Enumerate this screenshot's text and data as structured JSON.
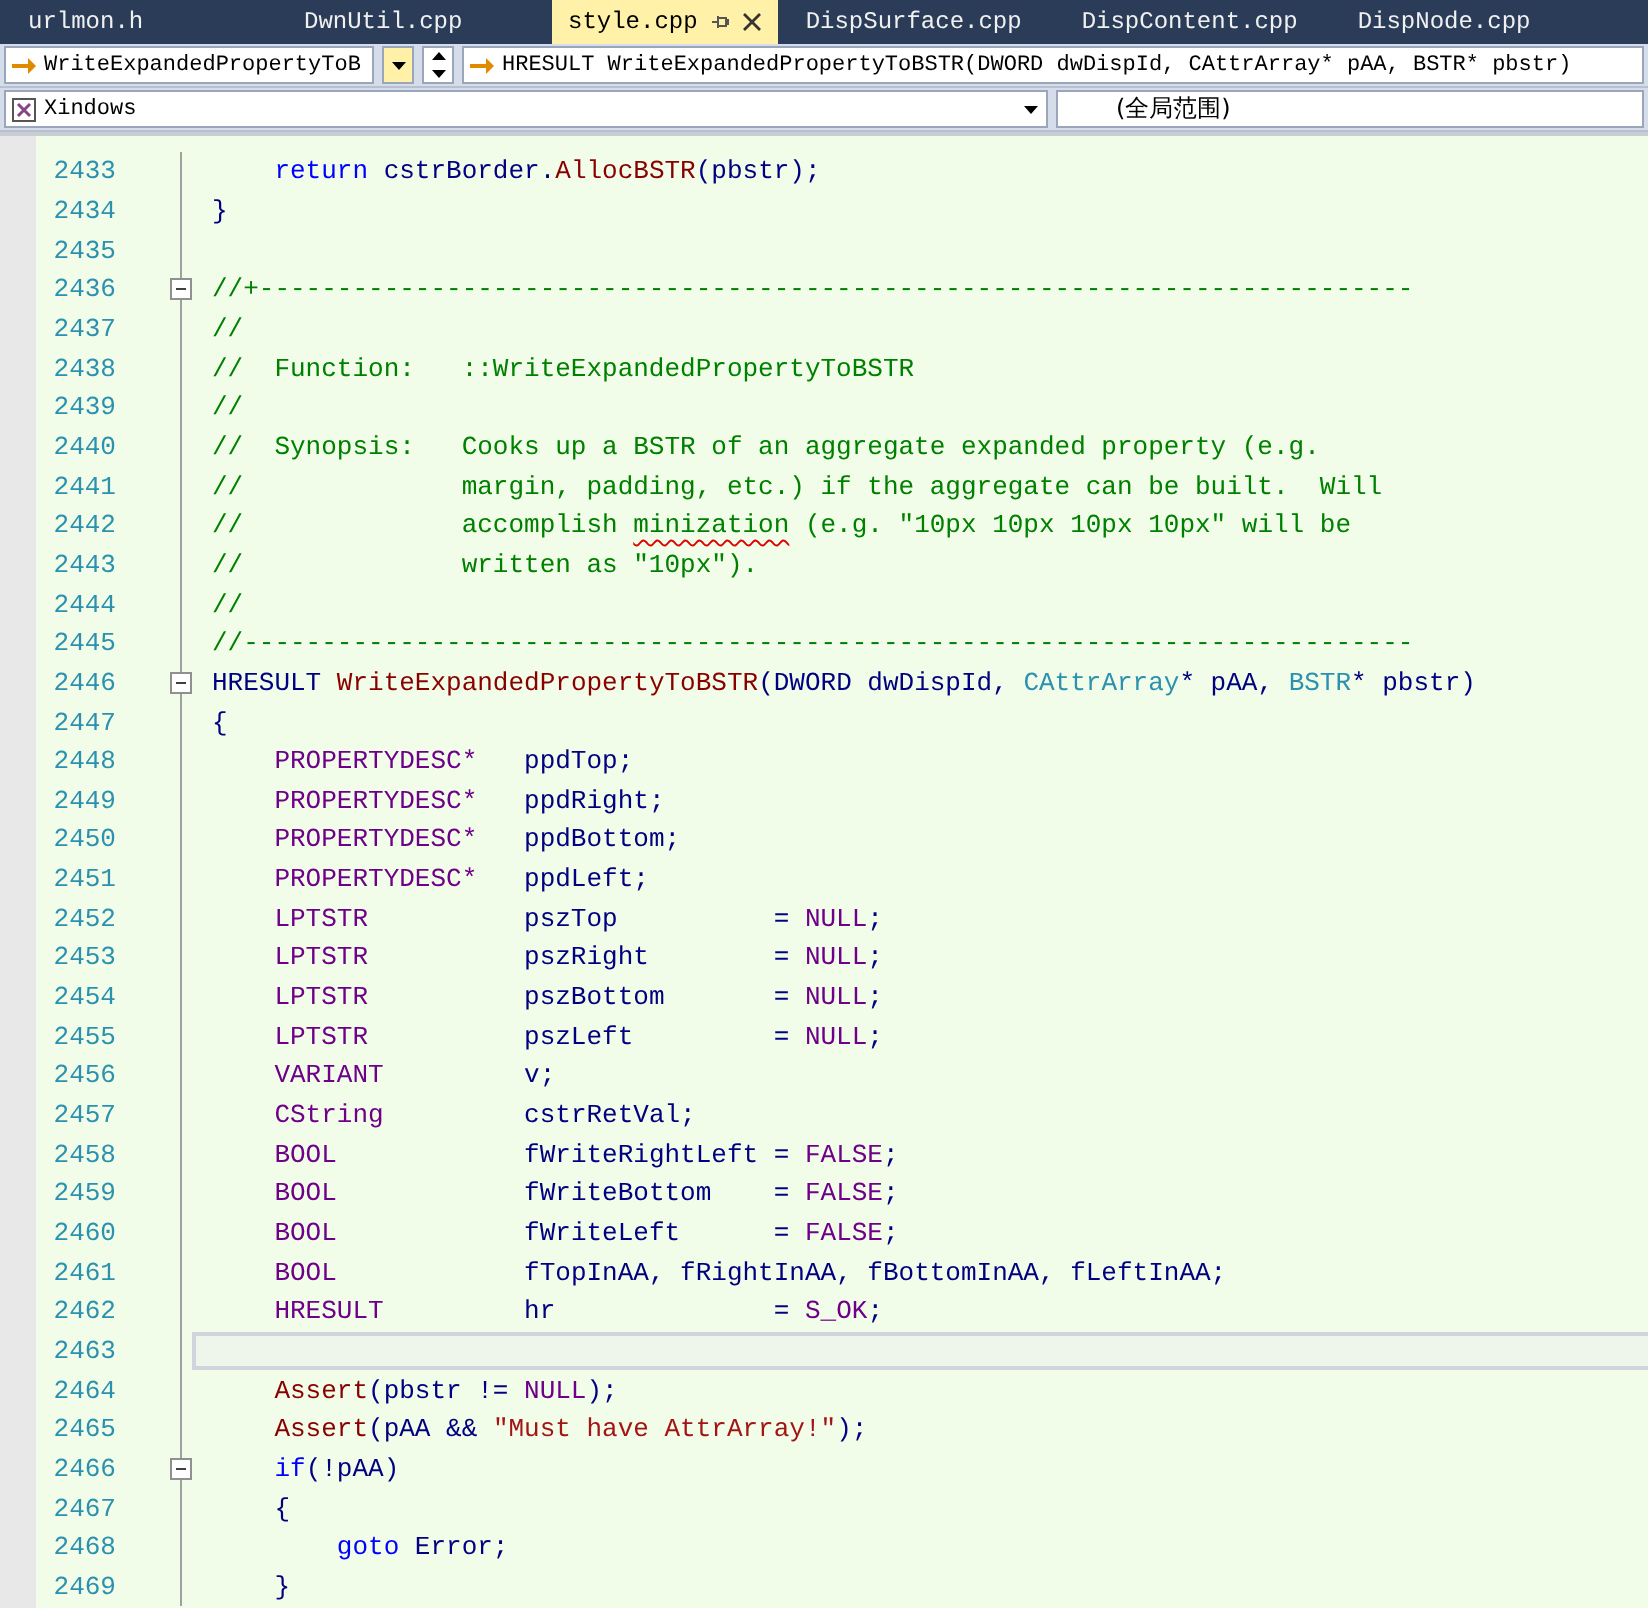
{
  "tabs": [
    {
      "label": "urlmon.h",
      "selected": false,
      "pinned": false
    },
    {
      "label": "DwnUtil.cpp",
      "selected": false,
      "pinned": false
    },
    {
      "label": "style.cpp",
      "selected": true,
      "pinned": true
    },
    {
      "label": "DispSurface.cpp",
      "selected": false,
      "pinned": false
    },
    {
      "label": "DispContent.cpp",
      "selected": false,
      "pinned": false
    },
    {
      "label": "DispNode.cpp",
      "selected": false,
      "pinned": false
    }
  ],
  "navigation": {
    "function_dropdown": "WriteExpandedPropertyToB",
    "signature": "HRESULT WriteExpandedPropertyToBSTR(DWORD dwDispId, CAttrArray* pAA, BSTR* pbstr)",
    "project_dropdown": "Xindows",
    "scope": "(全局范围)"
  },
  "editor": {
    "lines": [
      {
        "number": "2433",
        "collapsible": false,
        "current": false,
        "tokens": [
          {
            "text": "    return",
            "kind": "keyword"
          },
          {
            "text": " cstrBorder.",
            "kind": "plain"
          },
          {
            "text": "AllocBSTR",
            "kind": "function"
          },
          {
            "text": "(pbstr);",
            "kind": "plain"
          }
        ]
      },
      {
        "number": "2434",
        "collapsible": false,
        "current": false,
        "tokens": [
          {
            "text": "}",
            "kind": "plain"
          }
        ]
      },
      {
        "number": "2435",
        "collapsible": false,
        "current": false
      },
      {
        "number": "2436",
        "collapsible": true,
        "current": false,
        "tokens": [
          {
            "text": "//+--------------------------------------------------------------------------",
            "kind": "comment"
          }
        ]
      },
      {
        "number": "2437",
        "collapsible": false,
        "current": false,
        "tokens": [
          {
            "text": "//",
            "kind": "comment"
          }
        ]
      },
      {
        "number": "2438",
        "collapsible": false,
        "current": false,
        "tokens": [
          {
            "text": "//  Function:   ::WriteExpandedPropertyToBSTR",
            "kind": "comment"
          }
        ]
      },
      {
        "number": "2439",
        "collapsible": false,
        "current": false,
        "tokens": [
          {
            "text": "//",
            "kind": "comment"
          }
        ]
      },
      {
        "number": "2440",
        "collapsible": false,
        "current": false,
        "tokens": [
          {
            "text": "//  Synopsis:   Cooks up a BSTR of an aggregate expanded property (e.g.",
            "kind": "comment"
          }
        ]
      },
      {
        "number": "2441",
        "collapsible": false,
        "current": false,
        "tokens": [
          {
            "text": "//              margin, padding, etc.) if the aggregate can be built.  Will",
            "kind": "comment"
          }
        ]
      },
      {
        "number": "2442",
        "collapsible": false,
        "current": false,
        "tokens": [
          {
            "text": "//              accomplish ",
            "kind": "comment"
          },
          {
            "text": "minization",
            "kind": "comment",
            "misspelled": true
          },
          {
            "text": " (e.g. \"10px 10px 10px 10px\" will be",
            "kind": "comment"
          }
        ]
      },
      {
        "number": "2443",
        "collapsible": false,
        "current": false,
        "tokens": [
          {
            "text": "//              written as \"10px\").",
            "kind": "comment"
          }
        ]
      },
      {
        "number": "2444",
        "collapsible": false,
        "current": false,
        "tokens": [
          {
            "text": "//",
            "kind": "comment"
          }
        ]
      },
      {
        "number": "2445",
        "collapsible": false,
        "current": false,
        "tokens": [
          {
            "text": "//---------------------------------------------------------------------------",
            "kind": "comment"
          }
        ]
      },
      {
        "number": "2446",
        "collapsible": true,
        "current": false,
        "tokens": [
          {
            "text": "HRESULT ",
            "kind": "plain"
          },
          {
            "text": "WriteExpandedPropertyToBSTR",
            "kind": "function"
          },
          {
            "text": "(DWORD dwDispId, ",
            "kind": "plain"
          },
          {
            "text": "CAttrArray",
            "kind": "type"
          },
          {
            "text": "* pAA, ",
            "kind": "plain"
          },
          {
            "text": "BSTR",
            "kind": "type"
          },
          {
            "text": "* pbstr)",
            "kind": "plain"
          }
        ]
      },
      {
        "number": "2447",
        "collapsible": false,
        "current": false,
        "tokens": [
          {
            "text": "{",
            "kind": "plain"
          }
        ]
      },
      {
        "number": "2448",
        "collapsible": false,
        "current": false,
        "tokens": [
          {
            "text": "    PROPERTYDESC*",
            "kind": "macro"
          },
          {
            "text": "   ppdTop;",
            "kind": "plain"
          }
        ]
      },
      {
        "number": "2449",
        "collapsible": false,
        "current": false,
        "tokens": [
          {
            "text": "    PROPERTYDESC*",
            "kind": "macro"
          },
          {
            "text": "   ppdRight;",
            "kind": "plain"
          }
        ]
      },
      {
        "number": "2450",
        "collapsible": false,
        "current": false,
        "tokens": [
          {
            "text": "    PROPERTYDESC*",
            "kind": "macro"
          },
          {
            "text": "   ppdBottom;",
            "kind": "plain"
          }
        ]
      },
      {
        "number": "2451",
        "collapsible": false,
        "current": false,
        "tokens": [
          {
            "text": "    PROPERTYDESC*",
            "kind": "macro"
          },
          {
            "text": "   ppdLeft;",
            "kind": "plain"
          }
        ]
      },
      {
        "number": "2452",
        "collapsible": false,
        "current": false,
        "tokens": [
          {
            "text": "    LPTSTR",
            "kind": "macro"
          },
          {
            "text": "          pszTop          = ",
            "kind": "plain"
          },
          {
            "text": "NULL",
            "kind": "macro"
          },
          {
            "text": ";",
            "kind": "plain"
          }
        ]
      },
      {
        "number": "2453",
        "collapsible": false,
        "current": false,
        "tokens": [
          {
            "text": "    LPTSTR",
            "kind": "macro"
          },
          {
            "text": "          pszRight        = ",
            "kind": "plain"
          },
          {
            "text": "NULL",
            "kind": "macro"
          },
          {
            "text": ";",
            "kind": "plain"
          }
        ]
      },
      {
        "number": "2454",
        "collapsible": false,
        "current": false,
        "tokens": [
          {
            "text": "    LPTSTR",
            "kind": "macro"
          },
          {
            "text": "          pszBottom       = ",
            "kind": "plain"
          },
          {
            "text": "NULL",
            "kind": "macro"
          },
          {
            "text": ";",
            "kind": "plain"
          }
        ]
      },
      {
        "number": "2455",
        "collapsible": false,
        "current": false,
        "tokens": [
          {
            "text": "    LPTSTR",
            "kind": "macro"
          },
          {
            "text": "          pszLeft         = ",
            "kind": "plain"
          },
          {
            "text": "NULL",
            "kind": "macro"
          },
          {
            "text": ";",
            "kind": "plain"
          }
        ]
      },
      {
        "number": "2456",
        "collapsible": false,
        "current": false,
        "tokens": [
          {
            "text": "    VARIANT",
            "kind": "macro"
          },
          {
            "text": "         v;",
            "kind": "plain"
          }
        ]
      },
      {
        "number": "2457",
        "collapsible": false,
        "current": false,
        "tokens": [
          {
            "text": "    CString",
            "kind": "macro"
          },
          {
            "text": "         cstrRetVal;",
            "kind": "plain"
          }
        ]
      },
      {
        "number": "2458",
        "collapsible": false,
        "current": false,
        "tokens": [
          {
            "text": "    BOOL",
            "kind": "macro"
          },
          {
            "text": "            fWriteRightLeft = ",
            "kind": "plain"
          },
          {
            "text": "FALSE",
            "kind": "macro"
          },
          {
            "text": ";",
            "kind": "plain"
          }
        ]
      },
      {
        "number": "2459",
        "collapsible": false,
        "current": false,
        "tokens": [
          {
            "text": "    BOOL",
            "kind": "macro"
          },
          {
            "text": "            fWriteBottom    = ",
            "kind": "plain"
          },
          {
            "text": "FALSE",
            "kind": "macro"
          },
          {
            "text": ";",
            "kind": "plain"
          }
        ]
      },
      {
        "number": "2460",
        "collapsible": false,
        "current": false,
        "tokens": [
          {
            "text": "    BOOL",
            "kind": "macro"
          },
          {
            "text": "            fWriteLeft      = ",
            "kind": "plain"
          },
          {
            "text": "FALSE",
            "kind": "macro"
          },
          {
            "text": ";",
            "kind": "plain"
          }
        ]
      },
      {
        "number": "2461",
        "collapsible": false,
        "current": false,
        "tokens": [
          {
            "text": "    BOOL",
            "kind": "macro"
          },
          {
            "text": "            fTopInAA, fRightInAA, fBottomInAA, fLeftInAA;",
            "kind": "plain"
          }
        ]
      },
      {
        "number": "2462",
        "collapsible": false,
        "current": false,
        "tokens": [
          {
            "text": "    HRESULT",
            "kind": "macro"
          },
          {
            "text": "         hr              = ",
            "kind": "plain"
          },
          {
            "text": "S_OK",
            "kind": "macro"
          },
          {
            "text": ";",
            "kind": "plain"
          }
        ]
      },
      {
        "number": "2463",
        "collapsible": false,
        "current": true
      },
      {
        "number": "2464",
        "collapsible": false,
        "current": false,
        "tokens": [
          {
            "text": "    Assert",
            "kind": "function"
          },
          {
            "text": "(pbstr != ",
            "kind": "plain"
          },
          {
            "text": "NULL",
            "kind": "macro"
          },
          {
            "text": ");",
            "kind": "plain"
          }
        ]
      },
      {
        "number": "2465",
        "collapsible": false,
        "current": false,
        "tokens": [
          {
            "text": "    Assert",
            "kind": "function"
          },
          {
            "text": "(pAA && ",
            "kind": "plain"
          },
          {
            "text": "\"Must have AttrArray!\"",
            "kind": "string"
          },
          {
            "text": ");",
            "kind": "plain"
          }
        ]
      },
      {
        "number": "2466",
        "collapsible": true,
        "current": false,
        "tokens": [
          {
            "text": "    if",
            "kind": "keyword"
          },
          {
            "text": "(!pAA)",
            "kind": "plain"
          }
        ]
      },
      {
        "number": "2467",
        "collapsible": false,
        "current": false,
        "tokens": [
          {
            "text": "    {",
            "kind": "plain"
          }
        ]
      },
      {
        "number": "2468",
        "collapsible": false,
        "current": false,
        "tokens": [
          {
            "text": "        goto",
            "kind": "keyword"
          },
          {
            "text": " Error;",
            "kind": "plain"
          }
        ]
      },
      {
        "number": "2469",
        "collapsible": false,
        "current": false,
        "tokens": [
          {
            "text": "    }",
            "kind": "plain"
          }
        ]
      }
    ]
  }
}
